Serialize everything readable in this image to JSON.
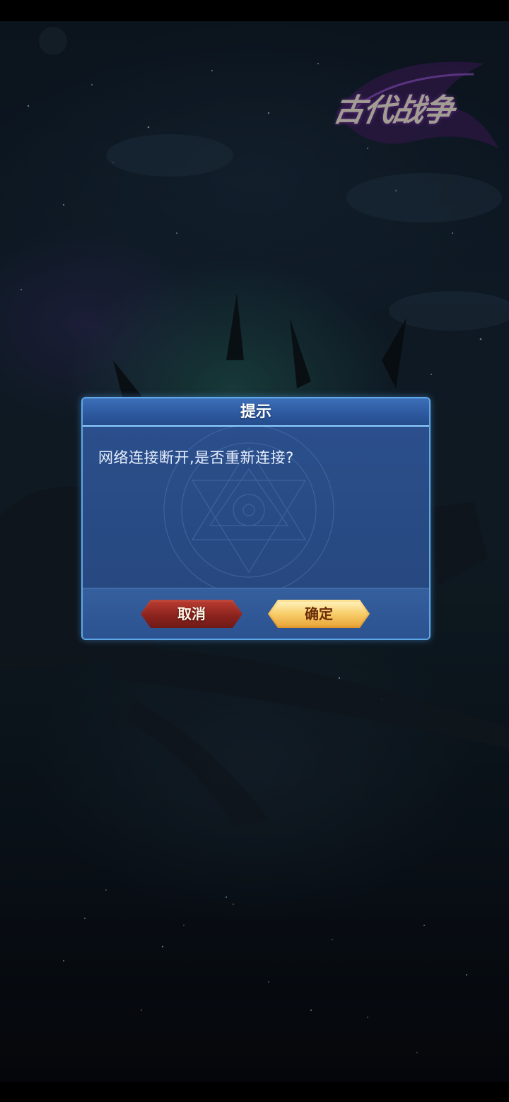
{
  "game": {
    "logo_text": "古代战争"
  },
  "dialog": {
    "title": "提示",
    "message": "网络连接断开,是否重新连接?",
    "cancel_label": "取消",
    "confirm_label": "确定"
  },
  "colors": {
    "dialog_border": "#5fa8e8",
    "dialog_body": "#27487f",
    "cancel_button": "#8e2420",
    "confirm_button": "#f5c15a"
  }
}
